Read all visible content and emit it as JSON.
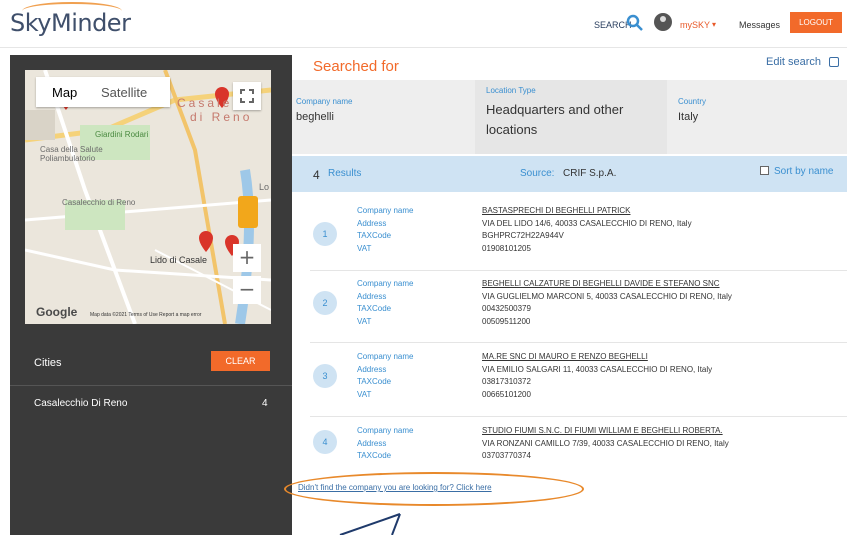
{
  "header": {
    "logo": "SkyMinder",
    "search_label": "SEARCH",
    "user_menu": "mySKY",
    "messages": "Messages",
    "logout": "LOGOUT"
  },
  "map": {
    "tab_map": "Map",
    "tab_satellite": "Satellite",
    "zoom_in": "+",
    "zoom_out": "−",
    "google": "Google",
    "footer": "Map data ©2021   Terms of Use   Report a map error",
    "labels": [
      "Casalecchio di Reno",
      "Lido di Casale",
      "Giardini Rodari",
      "Casa della Salute Poliambulatorio",
      "Casale",
      "di Reno",
      "Lo"
    ]
  },
  "sidebar": {
    "cities_label": "Cities",
    "clear_button": "CLEAR",
    "cities": [
      {
        "name": "Casalecchio Di Reno",
        "count": "4"
      }
    ]
  },
  "search": {
    "title": "Searched for",
    "edit": "Edit search",
    "company_label": "Company name",
    "company_value": "beghelli",
    "location_label": "Location Type",
    "location_value": "Headquarters and other locations",
    "country_label": "Country",
    "country_value": "Italy"
  },
  "results_bar": {
    "count": "4",
    "label": "Results",
    "source_label": "Source:",
    "source_value": "CRIF S.p.A.",
    "sort_label": "Sort by name"
  },
  "result_keys": [
    "Company name",
    "Address",
    "TAXCode",
    "VAT"
  ],
  "results": [
    {
      "num": "1",
      "name": "BASTASPRECHI DI BEGHELLI PATRICK",
      "address": "VIA DEL LIDO 14/6, 40033 CASALECCHIO DI RENO, Italy",
      "tax": "BGHPRC72H22A944V",
      "vat": "01908101205"
    },
    {
      "num": "2",
      "name": "BEGHELLI CALZATURE DI BEGHELLI DAVIDE E STEFANO SNC",
      "address": "VIA GUGLIELMO MARCONI 5, 40033 CASALECCHIO DI RENO, Italy",
      "tax": "00432500379",
      "vat": "00509511200"
    },
    {
      "num": "3",
      "name": "MA.RE SNC DI MAURO E RENZO BEGHELLI",
      "address": "VIA EMILIO SALGARI 11, 40033 CASALECCHIO DI RENO, Italy",
      "tax": "03817310372",
      "vat": "00665101200"
    },
    {
      "num": "4",
      "name": "STUDIO FIUMI S.N.C. DI FIUMI WILLIAM E BEGHELLI ROBERTA.",
      "address": "VIA RONZANI CAMILLO 7/39, 40033 CASALECCHIO DI RENO, Italy",
      "tax": "03703770374",
      "vat": ""
    }
  ],
  "not_found_link": "Didn't find the company you are looking for? Click here",
  "colors": {
    "accent": "#f26a2a",
    "link": "#3a8fd0",
    "sidebar": "#3a3a3a",
    "results_bar": "#cfe3f3",
    "highlight": "#e8892b"
  }
}
